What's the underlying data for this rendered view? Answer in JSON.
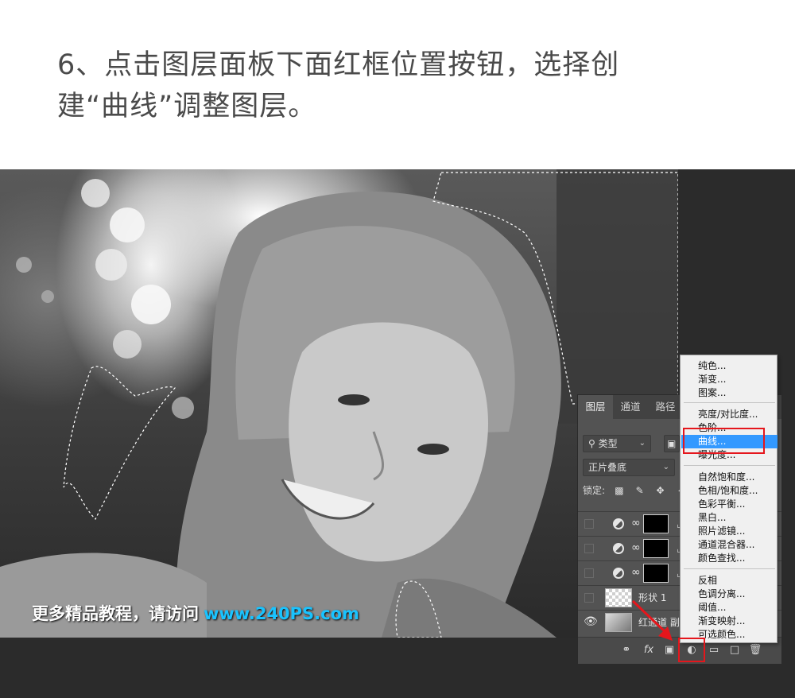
{
  "instruction": {
    "line1": "6、点击图层面板下面红框位置按钮，选择创",
    "line2": "建“曲线”调整图层。"
  },
  "watermark": {
    "text": "更多精品教程，请访问",
    "url": "www.240PS.com"
  },
  "colors": {
    "highlight": "#e5161c",
    "watermark_url": "#19c3ff",
    "menu_selected": "#3399ff"
  },
  "layers_panel": {
    "tabs": [
      "图层",
      "通道",
      "路径"
    ],
    "filter": {
      "icon": "search-icon",
      "label": "类型"
    },
    "blend_mode": "正片叠底",
    "lock_label": "锁定:",
    "layers": [
      {
        "type": "adjustment",
        "visible": false,
        "name": ""
      },
      {
        "type": "adjustment",
        "visible": false,
        "name": ""
      },
      {
        "type": "adjustment",
        "visible": false,
        "name": ""
      },
      {
        "type": "shape",
        "visible": false,
        "name": "形状 1"
      },
      {
        "type": "image",
        "visible": true,
        "name": "红通道 副"
      }
    ],
    "bottom_icons": [
      "link-icon",
      "fx-icon",
      "mask-icon",
      "adjustment-icon",
      "group-folder-icon",
      "new-layer-icon",
      "trash-icon"
    ]
  },
  "adjustment_menu": {
    "items": [
      "纯色...",
      "渐变...",
      "图案...",
      "亮度/对比度...",
      "色阶...",
      "曲线...",
      "曝光度...",
      "自然饱和度...",
      "色相/饱和度...",
      "色彩平衡...",
      "黑白...",
      "照片滤镜...",
      "通道混合器...",
      "颜色查找...",
      "反相",
      "色调分离...",
      "阈值...",
      "渐变映射...",
      "可选颜色..."
    ],
    "selected": "曲线..."
  }
}
